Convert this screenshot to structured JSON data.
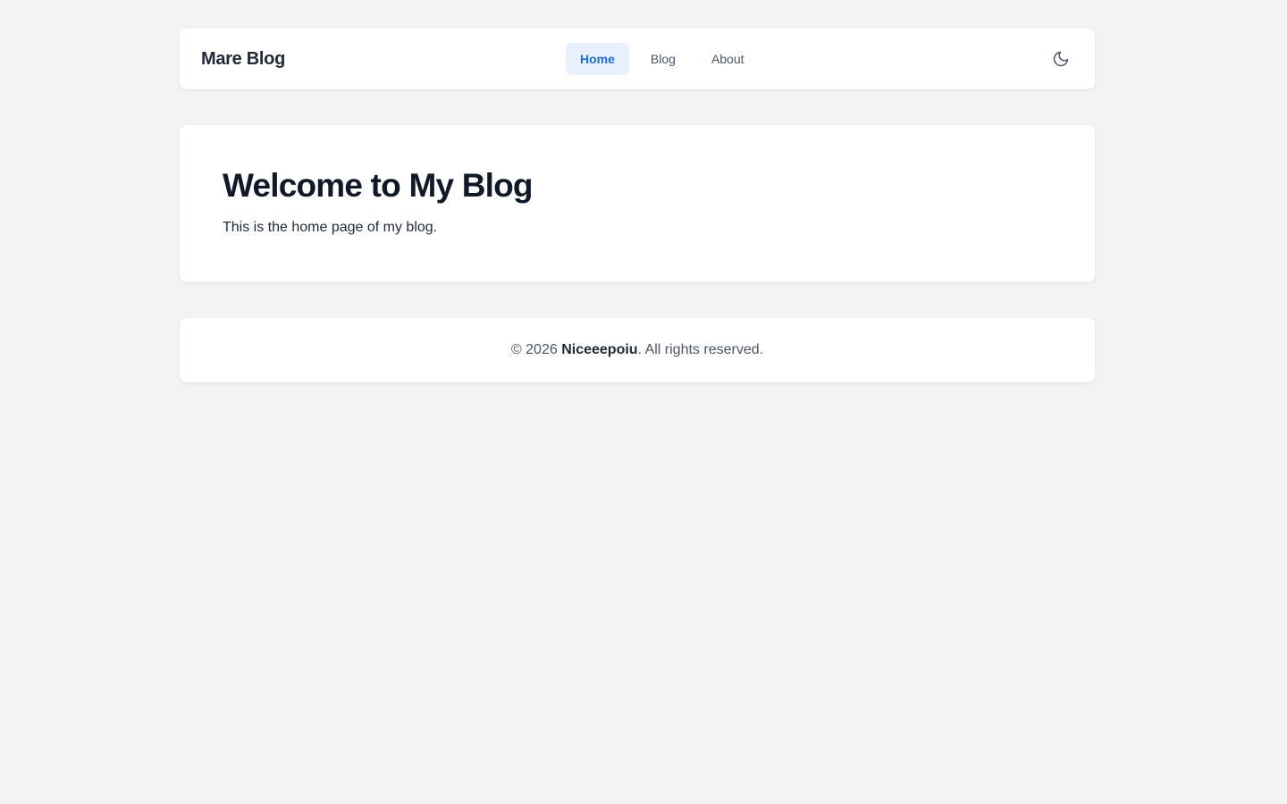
{
  "header": {
    "logo": "Mare Blog",
    "nav": [
      {
        "label": "Home",
        "active": true
      },
      {
        "label": "Blog",
        "active": false
      },
      {
        "label": "About",
        "active": false
      }
    ],
    "theme_toggle_icon": "moon-icon"
  },
  "hero": {
    "title": "Welcome to My Blog",
    "subtitle": "This is the home page of my blog."
  },
  "footer": {
    "prefix": "© 2026 ",
    "author": "Niceeepoiu",
    "suffix": ". All rights reserved."
  },
  "colors": {
    "background": "#f2f3f5",
    "card": "#ffffff",
    "accent": "#1a6fd6",
    "accent_bg": "#e8f0fd"
  }
}
